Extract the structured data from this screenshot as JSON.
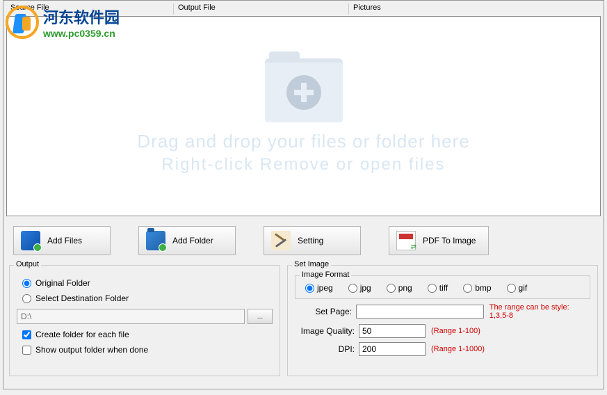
{
  "watermark": {
    "name": "河东软件园",
    "url": "www.pc0359.cn"
  },
  "tabs": {
    "source": "Source File",
    "output": "Output File",
    "pictures": "Pictures"
  },
  "dropzone": {
    "line1": "Drag and drop your files or folder here",
    "line2": "Right-click Remove or open files"
  },
  "toolbar": {
    "add_files": "Add Files",
    "add_folder": "Add Folder",
    "setting": "Setting",
    "pdf_to_image": "PDF To Image"
  },
  "output": {
    "legend": "Output",
    "original_folder": "Original Folder",
    "select_dest": "Select Destination Folder",
    "dest_path": "D:\\",
    "browse": "...",
    "create_folder": "Create folder for each file",
    "show_when_done": "Show output folder when done",
    "selected": "original",
    "create_folder_checked": true,
    "show_when_done_checked": false
  },
  "setimage": {
    "legend": "Set Image",
    "format_legend": "Image Format",
    "formats": [
      "jpeg",
      "jpg",
      "png",
      "tiff",
      "bmp",
      "gif"
    ],
    "format_selected": "jpeg",
    "set_page_label": "Set Page:",
    "set_page_value": "",
    "set_page_hint": "The range can be style:  1,3,5-8",
    "quality_label": "Image Quality:",
    "quality_value": "50",
    "quality_hint": "(Range 1-100)",
    "dpi_label": "DPI:",
    "dpi_value": "200",
    "dpi_hint": "(Range 1-1000)"
  }
}
